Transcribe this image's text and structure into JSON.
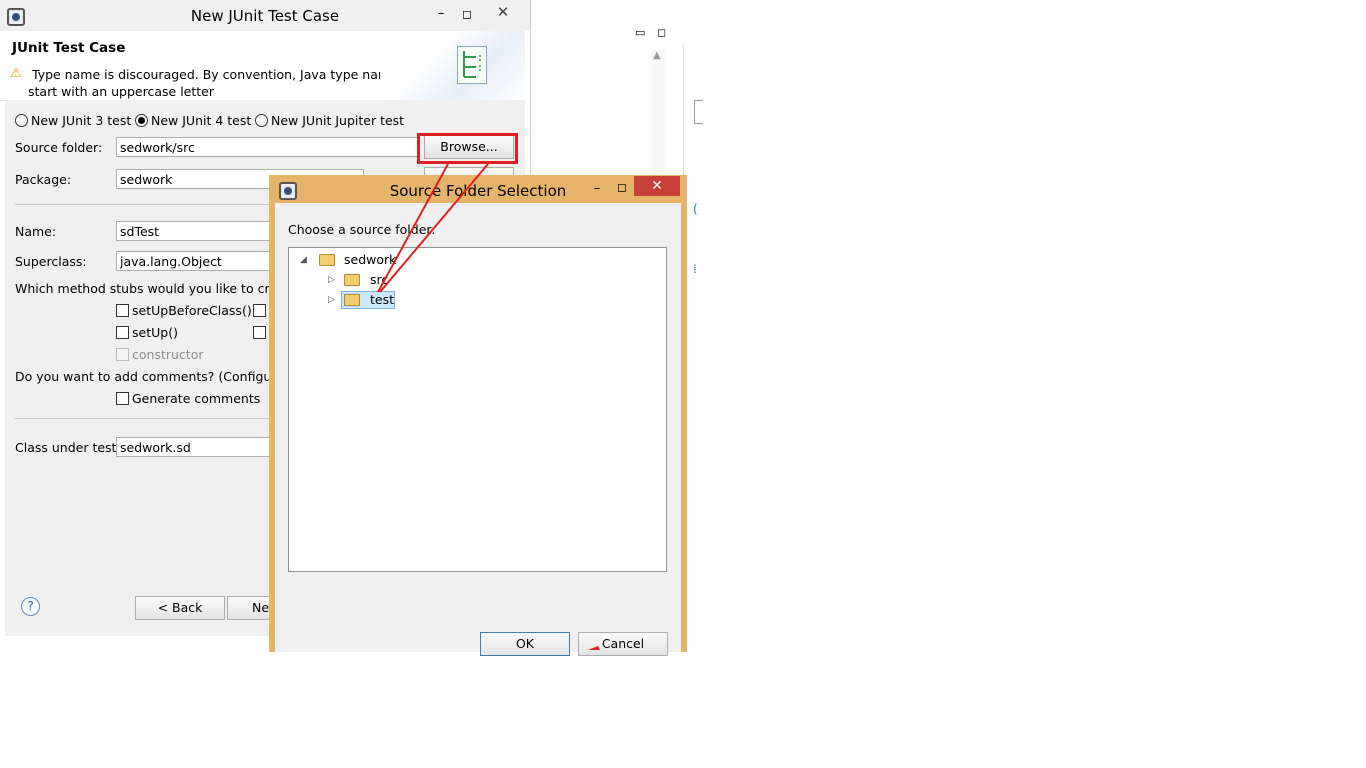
{
  "wizard": {
    "title": "New JUnit Test Case",
    "header_title": "JUnit Test Case",
    "warning_line1": "Type name is discouraged. By convention, Java type names usually",
    "warning_line2": "start with an uppercase letter",
    "radio_options": [
      {
        "label": "New JUnit 3 test",
        "selected": false
      },
      {
        "label": "New JUnit 4 test",
        "selected": true
      },
      {
        "label": "New JUnit Jupiter test",
        "selected": false
      }
    ],
    "source_folder_label": "Source folder:",
    "source_folder_value": "sedwork/src",
    "browse_label": "Browse...",
    "package_label": "Package:",
    "package_value": "sedwork",
    "name_label": "Name:",
    "name_value": "sdTest",
    "superclass_label": "Superclass:",
    "superclass_value": "java.lang.Object",
    "stubs_question": "Which method stubs would you like to creat",
    "stubs": [
      {
        "label": "setUpBeforeClass()",
        "enabled": true
      },
      {
        "label": "setUp()",
        "enabled": true
      },
      {
        "label": "constructor",
        "enabled": false
      }
    ],
    "comments_question": "Do you want to add comments? (Configure",
    "generate_comments_label": "Generate comments",
    "class_under_test_label": "Class under test:",
    "class_under_test_value": "sedwork.sd",
    "back_label": "< Back",
    "next_label": "Ne"
  },
  "dialog": {
    "title": "Source Folder Selection",
    "prompt": "Choose a source folder:",
    "tree": {
      "root": "sedwork",
      "children": [
        {
          "label": "src",
          "selected": false
        },
        {
          "label": "test",
          "selected": true
        }
      ]
    },
    "ok_label": "OK",
    "cancel_label": "Cancel"
  },
  "colors": {
    "dialog_frame": "#e6b36a",
    "close_button": "#c7403a",
    "annotation": "#e02020",
    "selection": "#cce8ff"
  }
}
